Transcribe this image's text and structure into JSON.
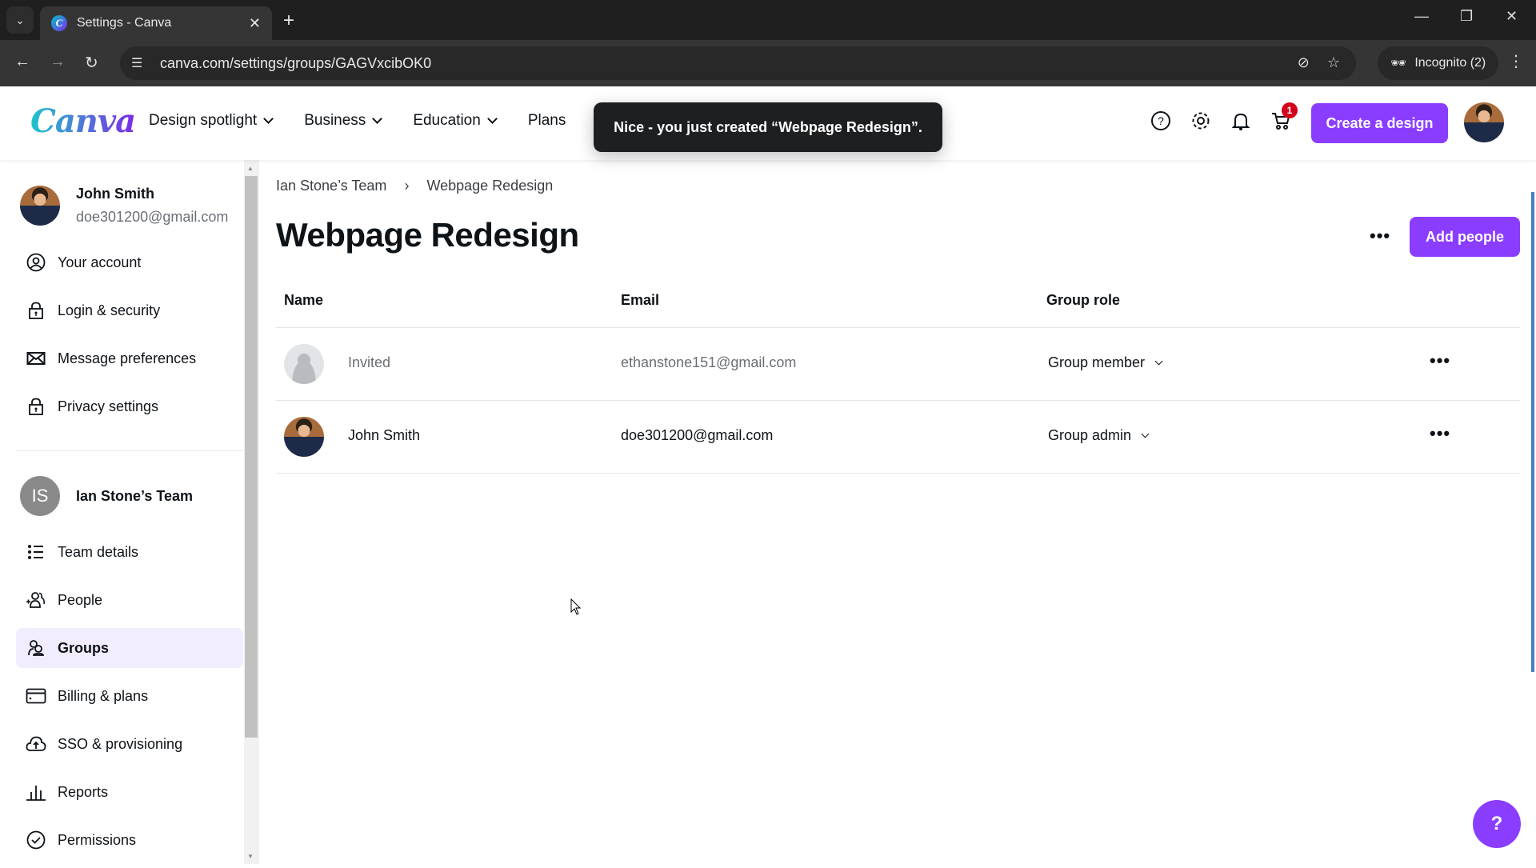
{
  "browser": {
    "tab_title": "Settings - Canva",
    "url": "canva.com/settings/groups/GAGVxcibOK0",
    "incognito_label": "Incognito (2)"
  },
  "header": {
    "logo": "Canva",
    "nav": [
      {
        "label": "Design spotlight",
        "has_dropdown": true
      },
      {
        "label": "Business",
        "has_dropdown": true
      },
      {
        "label": "Education",
        "has_dropdown": true
      },
      {
        "label": "Plans",
        "has_dropdown": false
      }
    ],
    "cart_count": "1",
    "create_button": "Create a design",
    "icons": [
      "help-icon",
      "settings-icon",
      "bell-icon",
      "cart-icon"
    ]
  },
  "toast": {
    "message": "Nice - you just created “Webpage Redesign”."
  },
  "sidebar": {
    "user": {
      "name": "John Smith",
      "email": "doe301200@gmail.com"
    },
    "account_items": [
      {
        "label": "Your account",
        "icon": "user-circle-icon"
      },
      {
        "label": "Login & security",
        "icon": "lock-icon"
      },
      {
        "label": "Message preferences",
        "icon": "envelope-icon"
      },
      {
        "label": "Privacy settings",
        "icon": "lock-icon"
      }
    ],
    "team": {
      "initials": "IS",
      "name": "Ian Stone’s Team"
    },
    "team_items": [
      {
        "label": "Team details",
        "icon": "list-icon",
        "active": false
      },
      {
        "label": "People",
        "icon": "add-people-icon",
        "active": false
      },
      {
        "label": "Groups",
        "icon": "groups-icon",
        "active": true
      },
      {
        "label": "Billing & plans",
        "icon": "credit-card-icon",
        "active": false
      },
      {
        "label": "SSO & provisioning",
        "icon": "cloud-upload-icon",
        "active": false
      },
      {
        "label": "Reports",
        "icon": "bar-chart-icon",
        "active": false
      },
      {
        "label": "Permissions",
        "icon": "check-circle-icon",
        "active": false
      }
    ]
  },
  "main": {
    "breadcrumb": [
      "Ian Stone’s Team",
      "Webpage Redesign"
    ],
    "title": "Webpage Redesign",
    "add_people_button": "Add people",
    "table": {
      "columns": [
        "Name",
        "Email",
        "Group role"
      ],
      "rows": [
        {
          "name": "Invited",
          "email": "ethanstone151@gmail.com",
          "role": "Group member",
          "status": "invited"
        },
        {
          "name": "John Smith",
          "email": "doe301200@gmail.com",
          "role": "Group admin",
          "status": "active"
        }
      ]
    }
  },
  "help_fab": "?",
  "colors": {
    "accent": "#8b3dff",
    "active_bg": "#f1ecfe",
    "badge": "#d0021b"
  }
}
